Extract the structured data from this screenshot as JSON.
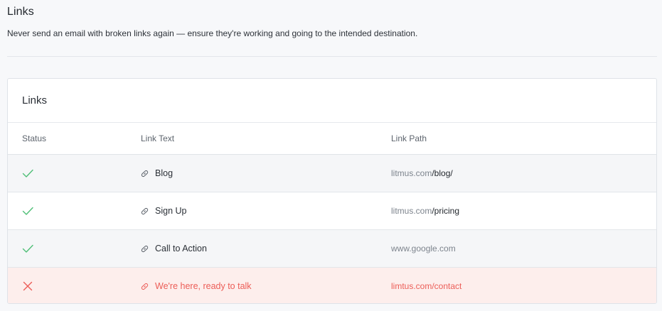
{
  "header": {
    "title": "Links",
    "subtitle": "Never send an email with broken links again — ensure they're working and going to the intended destination."
  },
  "card": {
    "title": "Links",
    "columns": {
      "status": "Status",
      "link_text": "Link Text",
      "link_path": "Link Path"
    },
    "rows": [
      {
        "status": "ok",
        "status_icon": "check-icon",
        "link_text": "Blog",
        "domain": "litmus.com",
        "path": "/blog/"
      },
      {
        "status": "ok",
        "status_icon": "check-icon",
        "link_text": "Sign Up",
        "domain": "litmus.com",
        "path": "/pricing"
      },
      {
        "status": "ok",
        "status_icon": "check-icon",
        "link_text": "Call to Action",
        "domain": "www.google.com",
        "path": ""
      },
      {
        "status": "error",
        "status_icon": "x-icon",
        "link_text": "We're here, ready to talk",
        "domain": "limtus.com/contact",
        "path": ""
      }
    ]
  },
  "colors": {
    "ok": "#4fbf77",
    "error": "#ec5d57",
    "error_row_bg": "#fdeeec",
    "link_icon": "#5a6069"
  }
}
